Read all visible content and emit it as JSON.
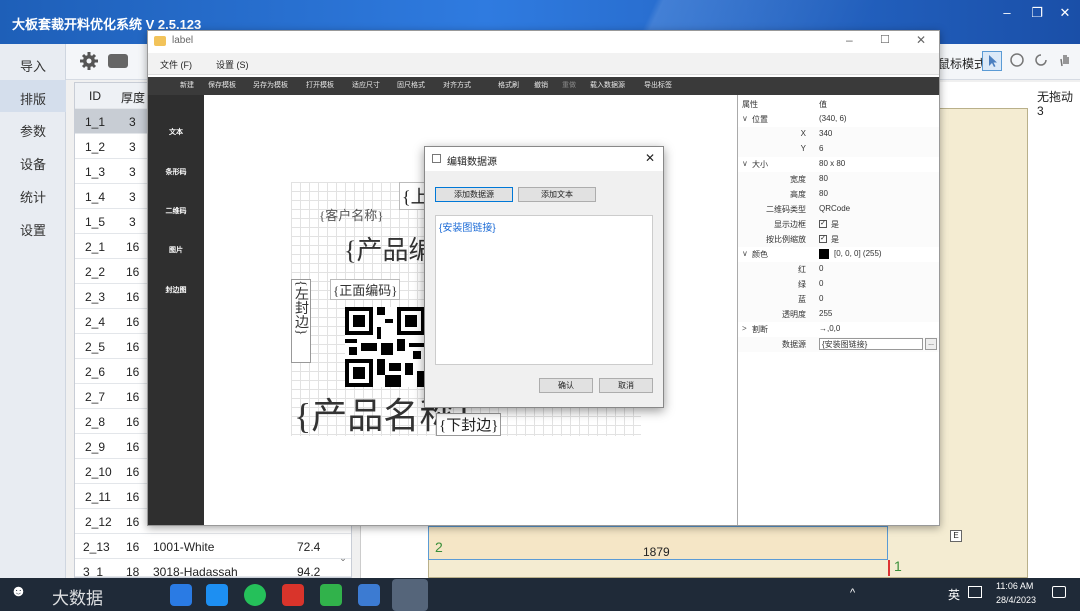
{
  "app": {
    "title": "大板套裁开料优化系统 V 2.5.123",
    "window_controls": [
      "–",
      "❐",
      "✕"
    ]
  },
  "leftnav": {
    "items": [
      {
        "label": "导入"
      },
      {
        "label": "排版",
        "active": true
      },
      {
        "label": "参数"
      },
      {
        "label": "设备"
      },
      {
        "label": "统计"
      },
      {
        "label": "设置"
      }
    ]
  },
  "toolbar": {
    "mode_label": "鼠标模式：",
    "right_label": "无拖动",
    "right_value": "3"
  },
  "grid": {
    "headers": [
      "ID",
      "厚度"
    ],
    "rows": [
      {
        "id": "1_1",
        "thk": "3"
      },
      {
        "id": "1_2",
        "thk": "3"
      },
      {
        "id": "1_3",
        "thk": "3"
      },
      {
        "id": "1_4",
        "thk": "3"
      },
      {
        "id": "1_5",
        "thk": "3"
      },
      {
        "id": "2_1",
        "thk": "16"
      },
      {
        "id": "2_2",
        "thk": "16"
      },
      {
        "id": "2_3",
        "thk": "16"
      },
      {
        "id": "2_4",
        "thk": "16"
      },
      {
        "id": "2_5",
        "thk": "16"
      },
      {
        "id": "2_6",
        "thk": "16"
      },
      {
        "id": "2_7",
        "thk": "16"
      },
      {
        "id": "2_8",
        "thk": "16"
      },
      {
        "id": "2_9",
        "thk": "16"
      },
      {
        "id": "2_10",
        "thk": "16"
      },
      {
        "id": "2_11",
        "thk": "16"
      },
      {
        "id": "2_12",
        "thk": "16"
      },
      {
        "id": "2_13",
        "thk": "16",
        "name": "1001-White",
        "len": "72.4"
      },
      {
        "id": "3_1",
        "thk": "18",
        "name": "3018-Hadassah",
        "len": "94.2"
      }
    ]
  },
  "layout_canvas": {
    "piece_number": "2",
    "piece_length": "1879",
    "marker": "1"
  },
  "label_window": {
    "title": "label",
    "menu": [
      "文件 (F)",
      "设置 (S)"
    ],
    "tools": [
      "新建",
      "保存模板",
      "另存为模板",
      "打开模板",
      "适应尺寸",
      "固尺格式",
      "对齐方式",
      "格式刷",
      "撤销",
      "重做",
      "载入数据源",
      "导出标签"
    ],
    "side": [
      "文本",
      "条形码",
      "二维码",
      "图片",
      "封边图"
    ],
    "canvas_texts": {
      "top": "{上",
      "customer": "{客户名称}",
      "product_top": "{产品编",
      "left_edge": "{左封边}",
      "front_code": "{正面编码}",
      "product_bottom": "{产品名称}",
      "bottom_edge": "{下封边}"
    }
  },
  "properties": {
    "header_key": "属性",
    "header_val": "值",
    "rows": [
      {
        "k": "位置",
        "v": "(340, 6)",
        "group": true,
        "exp": "∨"
      },
      {
        "k": "X",
        "v": "340"
      },
      {
        "k": "Y",
        "v": "6"
      },
      {
        "k": "大小",
        "v": "80 x 80",
        "group": true,
        "exp": "∨"
      },
      {
        "k": "宽度",
        "v": "80"
      },
      {
        "k": "高度",
        "v": "80"
      },
      {
        "k": "二维码类型",
        "v": "QRCode"
      },
      {
        "k": "显示边框",
        "v": "是",
        "check": true
      },
      {
        "k": "按比例缩放",
        "v": "是",
        "check": true
      },
      {
        "k": "颜色",
        "v": "[0, 0, 0] (255)",
        "group": true,
        "exp": "∨",
        "swatch": "#000000"
      },
      {
        "k": "红",
        "v": "0"
      },
      {
        "k": "绿",
        "v": "0"
      },
      {
        "k": "蓝",
        "v": "0"
      },
      {
        "k": "透明度",
        "v": "255"
      },
      {
        "k": "割断",
        "v": "→,0,0",
        "group": true,
        "exp": ">"
      },
      {
        "k": "数据源",
        "v": "{安装图链接}",
        "input": true
      }
    ]
  },
  "dialog": {
    "title": "编辑数据源",
    "add_source": "添加数据源",
    "add_text": "添加文本",
    "content": "{安装图链接}",
    "ok": "确认",
    "cancel": "取消"
  },
  "taskbar": {
    "watermark": "大数据",
    "ime": "英",
    "time": "11:06 AM",
    "date": "28/4/2023"
  }
}
